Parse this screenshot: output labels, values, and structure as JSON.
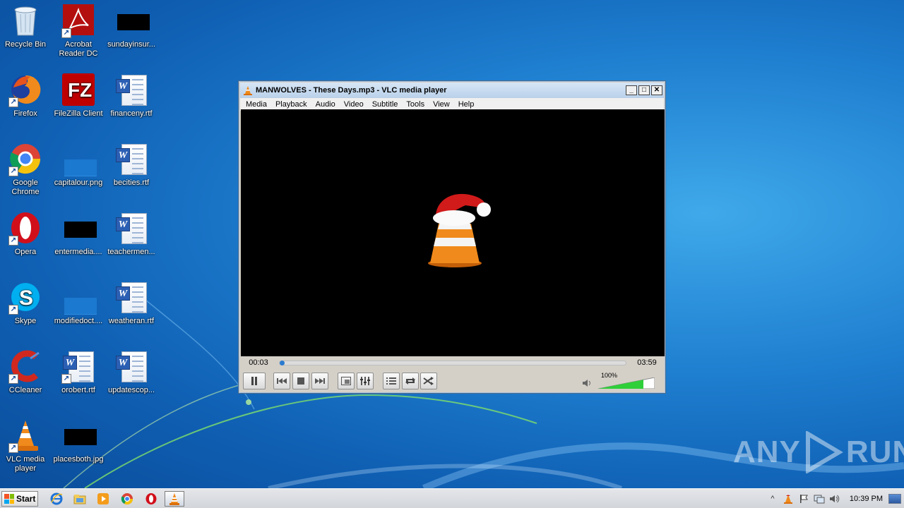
{
  "desktop": {
    "icons": [
      {
        "label": "Recycle Bin",
        "icon": "recycle-bin-icon"
      },
      {
        "label": "Acrobat Reader DC",
        "icon": "acrobat-icon"
      },
      {
        "label": "sundayinsur...",
        "icon": "image-thumbnail-icon"
      },
      {
        "label": "Firefox",
        "icon": "firefox-icon"
      },
      {
        "label": "FileZilla Client",
        "icon": "filezilla-icon"
      },
      {
        "label": "financeny.rtf",
        "icon": "word-doc-icon"
      },
      {
        "label": "Google Chrome",
        "icon": "chrome-icon"
      },
      {
        "label": "capitalour.png",
        "icon": "image-thumbnail-icon"
      },
      {
        "label": "becities.rtf",
        "icon": "word-doc-icon"
      },
      {
        "label": "Opera",
        "icon": "opera-icon"
      },
      {
        "label": "entermedia....",
        "icon": "image-thumbnail-icon"
      },
      {
        "label": "teachermen...",
        "icon": "word-doc-icon"
      },
      {
        "label": "Skype",
        "icon": "skype-icon"
      },
      {
        "label": "modifiedoct....",
        "icon": "image-thumbnail-icon"
      },
      {
        "label": "weatheran.rtf",
        "icon": "word-doc-icon"
      },
      {
        "label": "CCleaner",
        "icon": "ccleaner-icon"
      },
      {
        "label": "orobert.rtf",
        "icon": "word-doc-icon"
      },
      {
        "label": "updatescop...",
        "icon": "word-doc-icon"
      },
      {
        "label": "VLC media player",
        "icon": "vlc-icon"
      },
      {
        "label": "placesboth.jpg",
        "icon": "image-thumbnail-icon"
      }
    ]
  },
  "vlc": {
    "title": "MANWOLVES - These Days.mp3 - VLC media player",
    "window_buttons": {
      "minimize": "_",
      "maximize": "□",
      "close": "✕"
    },
    "menu": [
      "Media",
      "Playback",
      "Audio",
      "Video",
      "Subtitle",
      "Tools",
      "View",
      "Help"
    ],
    "elapsed": "00:03",
    "duration": "03:59",
    "progress_fraction": 0.013,
    "volume_label": "100%",
    "volume_fraction": 0.8,
    "controls": {
      "pause": "pause-icon",
      "previous": "previous-icon",
      "stop": "stop-icon",
      "next": "next-icon",
      "fullscreen": "fullscreen-icon",
      "extended": "extended-settings-icon",
      "playlist": "playlist-icon",
      "loop": "loop-icon",
      "shuffle": "shuffle-icon"
    }
  },
  "watermark": {
    "text_left": "ANY",
    "text_right": "RUN"
  },
  "taskbar": {
    "start_label": "Start",
    "pinned": [
      "internet-explorer-icon",
      "explorer-icon",
      "media-player-icon",
      "chrome-icon",
      "opera-icon",
      "vlc-icon"
    ],
    "clock": "10:39 PM"
  },
  "colors": {
    "accent": "#2a7bd1",
    "volume_green": "#2fcf3a"
  }
}
